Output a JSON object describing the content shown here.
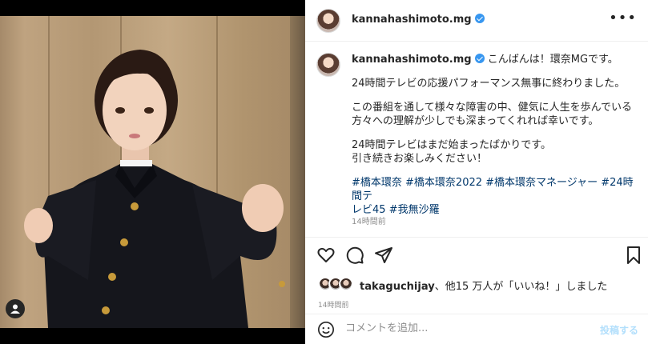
{
  "post": {
    "username": "kannahashimoto.mg",
    "more_label": "•••",
    "caption": {
      "line1": "こんばんは！環奈MGです。",
      "para2": "24時間テレビの応援パフォーマンス無事に終わりました。",
      "para3a": "この番組を通して様々な障害の中、健気に人生を歩んでいる",
      "para3b": "方々への理解が少しでも深まってくれれば幸いです。",
      "para4a": "24時間テレビはまだ始まったばかりです。",
      "para4b": "引き続きお楽しみください！",
      "hashtags1": "#橋本環奈 #橋本環奈2022 #橋本環奈マネージャー #24時間テ",
      "hashtags2": "レビ45 #我無沙羅"
    },
    "caption_time": "14時間前",
    "likes": {
      "user": "takaguchijay",
      "text": "、他15 万人が「いいね！」しました"
    },
    "post_time": "14時間前",
    "comment_placeholder": "コメントを追加...",
    "post_button": "投稿する"
  },
  "icons": [
    "heart-icon",
    "comment-icon",
    "share-icon",
    "bookmark-icon",
    "emoji-icon",
    "user-tag-icon",
    "verified-icon",
    "more-icon"
  ],
  "colors": {
    "hashtag": "#00376b",
    "verified": "#3897f0",
    "post_button_disabled": "#b2dffc",
    "muted": "#8e8e8e"
  }
}
